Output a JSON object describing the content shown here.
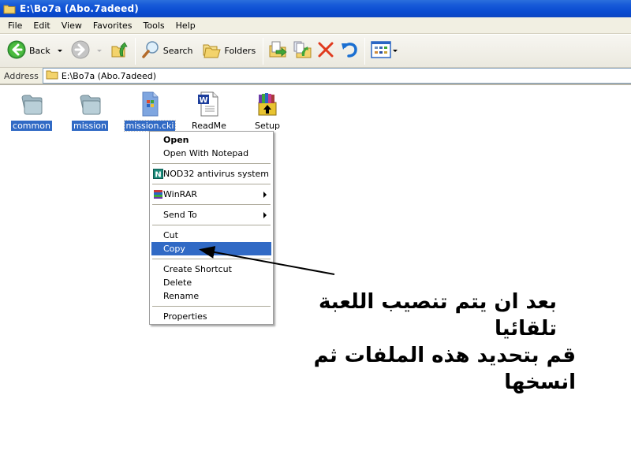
{
  "window": {
    "title": "E:\\Bo7a (Abo.7adeed)"
  },
  "menubar": {
    "items": [
      "File",
      "Edit",
      "View",
      "Favorites",
      "Tools",
      "Help"
    ]
  },
  "toolbar": {
    "back_label": "Back",
    "search_label": "Search",
    "folders_label": "Folders",
    "icons": [
      "back-icon",
      "forward-icon",
      "up-folder-icon",
      "search-icon",
      "folders-icon",
      "move-to-icon",
      "copy-to-icon",
      "delete-icon",
      "undo-icon",
      "views-icon"
    ]
  },
  "address": {
    "label": "Address",
    "value": "E:\\Bo7a (Abo.7adeed)"
  },
  "files": [
    {
      "name": "common",
      "type": "folder",
      "selected": true
    },
    {
      "name": "mission",
      "type": "folder",
      "selected": true
    },
    {
      "name": "mission.cki",
      "type": "file",
      "selected": true,
      "focused": true
    },
    {
      "name": "ReadMe",
      "type": "word-document",
      "selected": false
    },
    {
      "name": "Setup",
      "type": "winrar-installer",
      "selected": false
    }
  ],
  "context_menu": {
    "groups": [
      [
        {
          "label": "Open",
          "bold": true
        },
        {
          "label": "Open With Notepad"
        }
      ],
      [
        {
          "label": "NOD32 antivirus system",
          "icon": "nod32-icon"
        }
      ],
      [
        {
          "label": "WinRAR",
          "icon": "winrar-icon",
          "submenu": true
        }
      ],
      [
        {
          "label": "Send To",
          "submenu": true
        }
      ],
      [
        {
          "label": "Cut"
        },
        {
          "label": "Copy",
          "highlighted": true
        }
      ],
      [
        {
          "label": "Create Shortcut"
        },
        {
          "label": "Delete"
        },
        {
          "label": "Rename"
        }
      ],
      [
        {
          "label": "Properties"
        }
      ]
    ]
  },
  "annotation": {
    "line1": "بعد ان يتم تنصيب اللعبة تلقائيا",
    "line2": "قم بتحديد هذه الملفات ثم انسخها"
  },
  "colors": {
    "selection": "#316ac5",
    "titlebar": "#0a4bd0",
    "delete_red": "#e03a1e"
  }
}
